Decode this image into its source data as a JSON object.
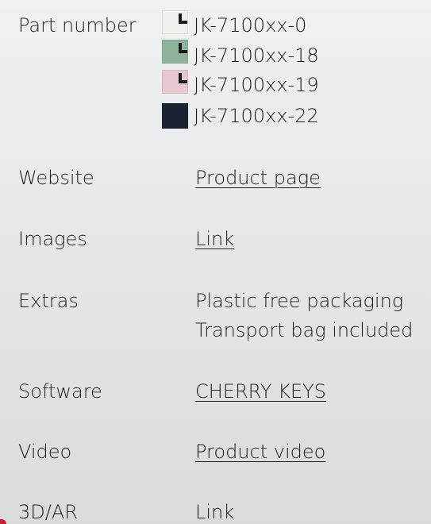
{
  "rows": {
    "part_number": {
      "label": "Part number",
      "variants": [
        {
          "code": "JK-7100xx-0",
          "color": "#eef0ec",
          "icon": "keycap-corner-icon"
        },
        {
          "code": "JK-7100xx-18",
          "color": "#8fb39a",
          "icon": "keycap-corner-icon"
        },
        {
          "code": "JK-7100xx-19",
          "color": "#e8c8cf",
          "icon": "keycap-corner-icon"
        },
        {
          "code": "JK-7100xx-22",
          "color": "#1b2333",
          "icon": "keycap-corner-icon"
        }
      ]
    },
    "website": {
      "label": "Website",
      "value": "Product page"
    },
    "images": {
      "label": "Images",
      "value": "Link"
    },
    "extras": {
      "label": "Extras",
      "lines": [
        "Plastic free packaging",
        "Transport bag included"
      ]
    },
    "software": {
      "label": "Software",
      "value": "CHERRY KEYS"
    },
    "video": {
      "label": "Video",
      "value": "Product video"
    },
    "ar": {
      "label": "3D/AR",
      "value": "Link"
    }
  },
  "colors": {
    "text": "#1e1e1e",
    "background": "#e6e7e9",
    "accent_red": "#c72030"
  }
}
